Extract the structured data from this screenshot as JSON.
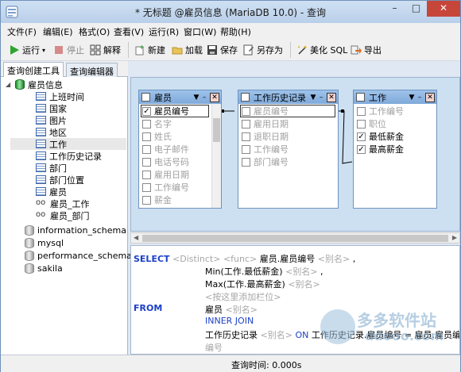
{
  "window": {
    "title": "* 无标题 @雇员信息 (MariaDB 10.0) - 查询",
    "minimize": "–",
    "maximize": "□",
    "close": "✕"
  },
  "menu": [
    "文件(F)",
    "编辑(E)",
    "格式(O)",
    "查看(V)",
    "运行(R)",
    "窗口(W)",
    "帮助(H)"
  ],
  "toolbar": {
    "run": "运行",
    "stop": "停止",
    "explain": "解释",
    "new": "新建",
    "load": "加载",
    "save": "保存",
    "save_as": "另存为",
    "beautify": "美化 SQL",
    "export": "导出"
  },
  "left_tabs": [
    "查询创建工具",
    "查询编辑器"
  ],
  "tree": {
    "db_selected": "雇员信息",
    "tables": [
      "上班时间",
      "国家",
      "图片",
      "地区",
      "工作",
      "工作历史记录",
      "部门",
      "部门位置",
      "雇员"
    ],
    "views": [
      "雇员_工作",
      "雇员_部门"
    ],
    "other_dbs": [
      "information_schema",
      "mysql",
      "performance_schema",
      "sakila"
    ]
  },
  "boxes": {
    "employee": {
      "name": "雇员",
      "fields": [
        "雇员编号",
        "名字",
        "姓氏",
        "电子邮件",
        "电话号码",
        "雇用日期",
        "工作编号",
        "薪金"
      ],
      "checked": [
        true,
        false,
        false,
        false,
        false,
        false,
        false,
        false
      ]
    },
    "history": {
      "name": "工作历史记录",
      "fields": [
        "雇员编号",
        "雇用日期",
        "退职日期",
        "工作编号",
        "部门编号"
      ],
      "checked": [
        false,
        false,
        false,
        false,
        false
      ]
    },
    "job": {
      "name": "工作",
      "fields": [
        "工作编号",
        "职位",
        "最低薪金",
        "最高薪金"
      ],
      "checked": [
        false,
        false,
        true,
        true
      ]
    }
  },
  "sql": {
    "select": "SELECT",
    "distinct": "<Distinct>",
    "func": "<func>",
    "col1": "雇员.雇员编号",
    "alias": "<别名>",
    "comma": ",",
    "col2": "Min(工作.最低薪金)",
    "col3": "Max(工作.最高薪金)",
    "add_col": "<按这里添加栏位>",
    "from": "FROM",
    "t1": "雇员",
    "join": "INNER JOIN",
    "t2": "工作历史记录",
    "on": "ON",
    "cond": "工作历史记录.雇员编号 = 雇员.雇员编",
    "more": "编号"
  },
  "status": "查询时间: 0.000s",
  "watermark": {
    "cn": "多多软件站",
    "en": "ddooo.com"
  }
}
